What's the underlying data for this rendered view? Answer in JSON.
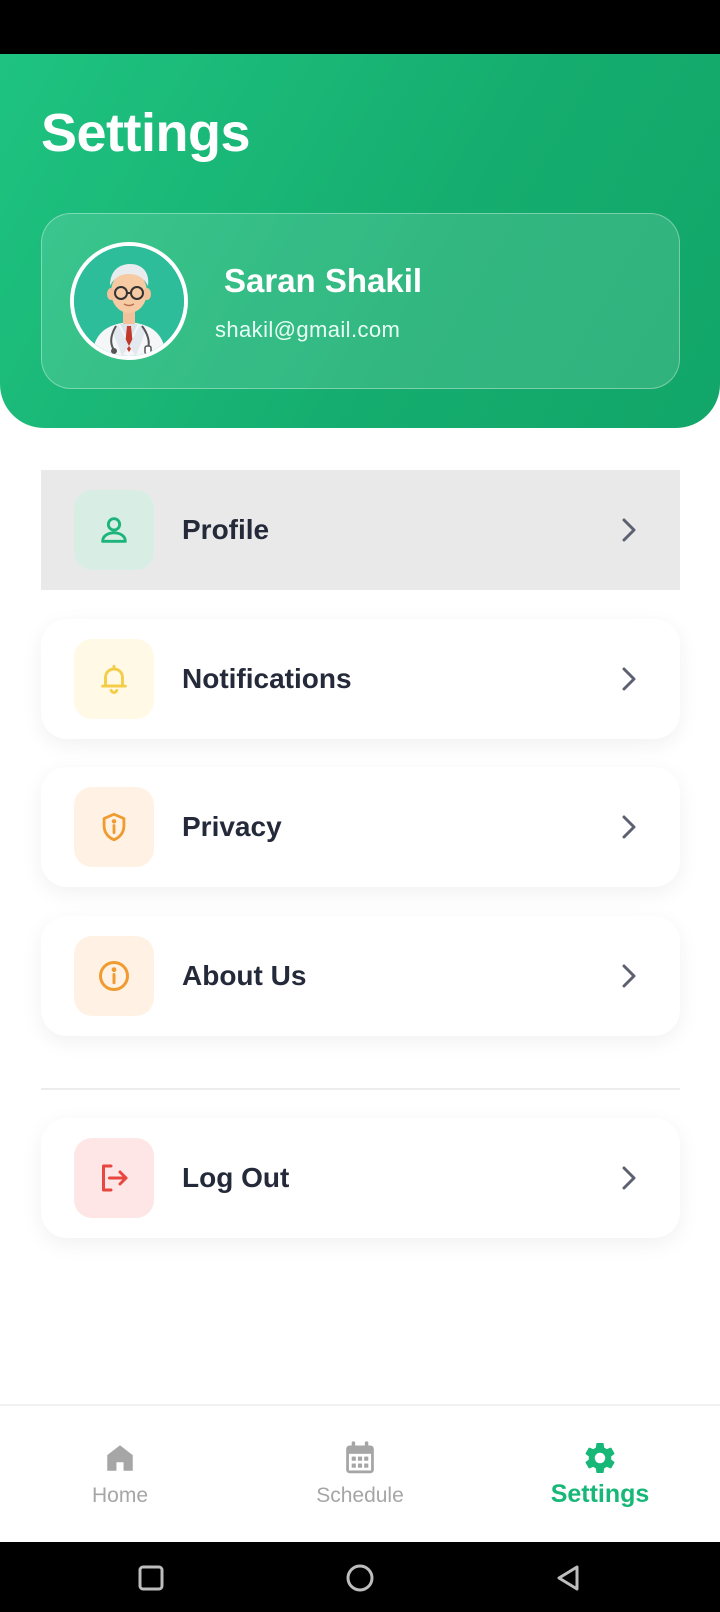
{
  "header": {
    "title": "Settings"
  },
  "user": {
    "name": "Saran Shakil",
    "email": "shakil@gmail.com",
    "avatar_icon": "doctor-avatar-icon"
  },
  "menu": [
    {
      "label": "Profile",
      "icon": "user-icon",
      "icon_bg": "#d8eee5",
      "icon_color": "#1cb47a",
      "active": true
    },
    {
      "label": "Notifications",
      "icon": "bell-icon",
      "icon_bg": "#fff9e6",
      "icon_color": "#f4cc45",
      "active": false
    },
    {
      "label": "Privacy",
      "icon": "shield-info-icon",
      "icon_bg": "#fff2e4",
      "icon_color": "#f09b30",
      "active": false
    },
    {
      "label": "About Us",
      "icon": "info-circle-icon",
      "icon_bg": "#fff2e4",
      "icon_color": "#f09b30",
      "active": false
    },
    {
      "label": "Log Out",
      "icon": "logout-icon",
      "icon_bg": "#fde6e5",
      "icon_color": "#e8473f",
      "active": false
    }
  ],
  "bottom_nav": [
    {
      "label": "Home",
      "icon": "home-icon",
      "selected": false
    },
    {
      "label": "Schedule",
      "icon": "calendar-icon",
      "selected": false
    },
    {
      "label": "Settings",
      "icon": "gear-icon",
      "selected": true
    }
  ],
  "colors": {
    "brand_green": "#17b877",
    "chevron": "#5c6070",
    "inactive_nav": "#a6a6a6"
  },
  "system_nav": [
    "recent-apps-icon",
    "home-circle-icon",
    "back-icon"
  ]
}
